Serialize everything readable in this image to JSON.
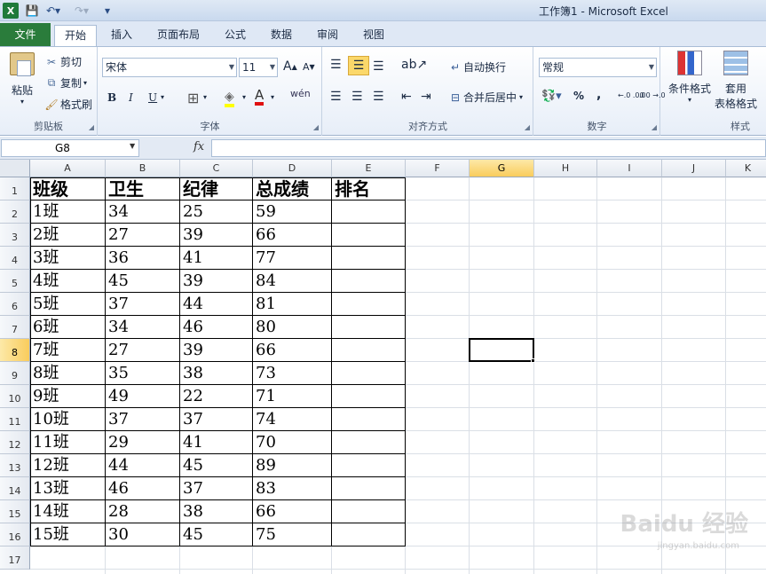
{
  "title": "工作簿1 - Microsoft Excel",
  "quick_access": {
    "logo": "X",
    "save_icon": "💾",
    "undo_icon": "↶▾",
    "redo_icon": "↷▾",
    "more_icon": "▾"
  },
  "tabs": {
    "file": "文件",
    "home": "开始",
    "insert": "插入",
    "layout": "页面布局",
    "formula": "公式",
    "data": "数据",
    "review": "审阅",
    "view": "视图"
  },
  "ribbon": {
    "clipboard": {
      "label": "剪贴板",
      "paste": "粘贴",
      "cut": "剪切",
      "copy": "复制",
      "format_painter": "格式刷"
    },
    "font": {
      "label": "字体",
      "font_name": "宋体",
      "font_size": "11",
      "grow": "A",
      "shrink": "A",
      "bold": "B",
      "italic": "I",
      "underline": "U"
    },
    "alignment": {
      "label": "对齐方式",
      "wrap_text": "自动换行",
      "merge_center": "合并后居中"
    },
    "number": {
      "label": "数字",
      "format": "常规",
      "percent": "%",
      "comma": ",",
      "inc_decimal": "←.0 .00",
      "dec_decimal": ".00 →.0"
    },
    "styles": {
      "label": "样式",
      "conditional": "条件格式",
      "table_format_1": "套用",
      "table_format_2": "表格格式"
    }
  },
  "formula_bar": {
    "name_box": "G8",
    "fx": "fx",
    "value": ""
  },
  "sheet": {
    "columns": [
      "A",
      "B",
      "C",
      "D",
      "E",
      "F",
      "G",
      "H",
      "I",
      "J",
      "K"
    ],
    "rows": [
      "1",
      "2",
      "3",
      "4",
      "5",
      "6",
      "7",
      "8",
      "9",
      "10",
      "11",
      "12",
      "13",
      "14",
      "15",
      "16",
      "17"
    ],
    "selected_col": "G",
    "selected_row": "8",
    "header": [
      "班级",
      "卫生",
      "纪律",
      "总成绩",
      "排名"
    ],
    "data": [
      [
        "1班",
        "34",
        "25",
        "59",
        ""
      ],
      [
        "2班",
        "27",
        "39",
        "66",
        ""
      ],
      [
        "3班",
        "36",
        "41",
        "77",
        ""
      ],
      [
        "4班",
        "45",
        "39",
        "84",
        ""
      ],
      [
        "5班",
        "37",
        "44",
        "81",
        ""
      ],
      [
        "6班",
        "34",
        "46",
        "80",
        ""
      ],
      [
        "7班",
        "27",
        "39",
        "66",
        ""
      ],
      [
        "8班",
        "35",
        "38",
        "73",
        ""
      ],
      [
        "9班",
        "49",
        "22",
        "71",
        ""
      ],
      [
        "10班",
        "37",
        "37",
        "74",
        ""
      ],
      [
        "11班",
        "29",
        "41",
        "70",
        ""
      ],
      [
        "12班",
        "44",
        "45",
        "89",
        ""
      ],
      [
        "13班",
        "46",
        "37",
        "83",
        ""
      ],
      [
        "14班",
        "28",
        "38",
        "66",
        ""
      ],
      [
        "15班",
        "30",
        "45",
        "75",
        ""
      ]
    ]
  },
  "watermark": {
    "main": "Baidu 经验",
    "sub": "jingyan.baidu.com"
  }
}
